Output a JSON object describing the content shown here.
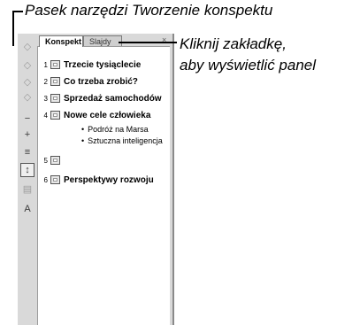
{
  "callouts": {
    "toolbar_label": "Pasek narzędzi Tworzenie konspektu",
    "tab_label_line1": "Kliknij zakładkę,",
    "tab_label_line2": "aby wyświetlić panel"
  },
  "panel": {
    "tabs": [
      {
        "label": "Konspekt",
        "active": true
      },
      {
        "label": "Slajdy",
        "active": false
      }
    ],
    "close_glyph": "×"
  },
  "toolbar": {
    "buttons": [
      {
        "name": "promote-icon",
        "glyph": "◇"
      },
      {
        "name": "demote-icon",
        "glyph": "◇"
      },
      {
        "name": "move-up-icon",
        "glyph": "◇"
      },
      {
        "name": "move-down-icon",
        "glyph": "◇"
      },
      {
        "name": "collapse-icon",
        "glyph": "−"
      },
      {
        "name": "expand-icon",
        "glyph": "+"
      },
      {
        "name": "collapse-all-icon",
        "glyph": "≡"
      },
      {
        "name": "expand-all-icon",
        "glyph": "↕"
      },
      {
        "name": "summary-slide-icon",
        "glyph": "▤"
      },
      {
        "name": "show-formatting-icon",
        "glyph": "A"
      }
    ]
  },
  "outline": {
    "slides": [
      {
        "number": "1",
        "title": "Trzecie tysiąclecie"
      },
      {
        "number": "2",
        "title": "Co trzeba zrobić?"
      },
      {
        "number": "3",
        "title": "Sprzedaż samochodów"
      },
      {
        "number": "4",
        "title": "Nowe cele człowieka"
      },
      {
        "number": "5",
        "title": ""
      },
      {
        "number": "6",
        "title": "Perspektywy rozwoju"
      }
    ],
    "bullets": [
      "Podróż na Marsa",
      "Sztuczna inteligencja"
    ]
  }
}
